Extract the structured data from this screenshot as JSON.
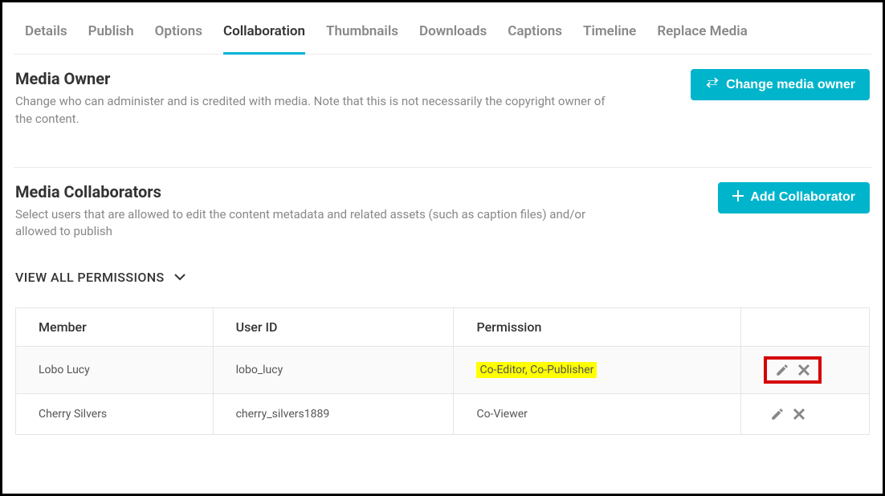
{
  "tabs": [
    {
      "label": "Details",
      "active": false
    },
    {
      "label": "Publish",
      "active": false
    },
    {
      "label": "Options",
      "active": false
    },
    {
      "label": "Collaboration",
      "active": true
    },
    {
      "label": "Thumbnails",
      "active": false
    },
    {
      "label": "Downloads",
      "active": false
    },
    {
      "label": "Captions",
      "active": false
    },
    {
      "label": "Timeline",
      "active": false
    },
    {
      "label": "Replace Media",
      "active": false
    }
  ],
  "owner": {
    "title": "Media Owner",
    "desc": "Change who can administer and is credited with media. Note that this is not necessarily the copyright owner of the content.",
    "button": "Change media owner"
  },
  "collab": {
    "title": "Media Collaborators",
    "desc": "Select users that are allowed to edit the content metadata and related assets (such as caption files) and/or allowed to publish",
    "button": "Add Collaborator",
    "view_all": "VIEW ALL PERMISSIONS",
    "columns": {
      "member": "Member",
      "userid": "User ID",
      "permission": "Permission"
    },
    "rows": [
      {
        "member": "Lobo Lucy",
        "userid": "lobo_lucy",
        "permission": "Co-Editor, Co-Publisher",
        "highlight": true,
        "boxed": true
      },
      {
        "member": "Cherry Silvers",
        "userid": "cherry_silvers1889",
        "permission": "Co-Viewer",
        "highlight": false,
        "boxed": false
      }
    ]
  }
}
